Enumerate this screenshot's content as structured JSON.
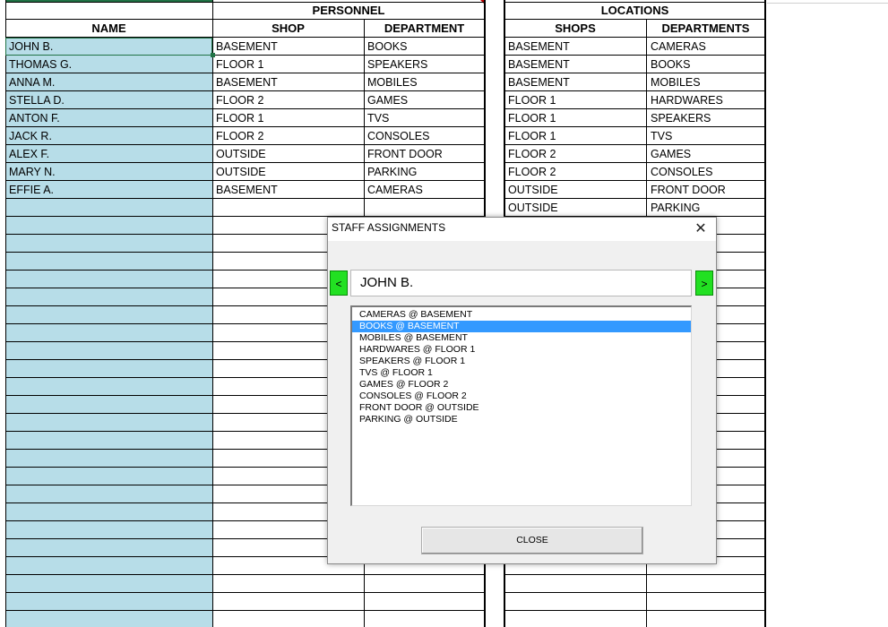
{
  "personnel": {
    "title": "PERSONNEL",
    "headers": {
      "name": "NAME",
      "shop": "SHOP",
      "department": "DEPARTMENT"
    },
    "rows": [
      {
        "name": "JOHN B.",
        "shop": "BASEMENT",
        "department": "BOOKS"
      },
      {
        "name": "THOMAS G.",
        "shop": "FLOOR 1",
        "department": "SPEAKERS"
      },
      {
        "name": "ANNA M.",
        "shop": "BASEMENT",
        "department": "MOBILES"
      },
      {
        "name": "STELLA D.",
        "shop": "FLOOR 2",
        "department": "GAMES"
      },
      {
        "name": "ANTON F.",
        "shop": "FLOOR 1",
        "department": "TVS"
      },
      {
        "name": "JACK R.",
        "shop": "FLOOR 2",
        "department": "CONSOLES"
      },
      {
        "name": "ALEX F.",
        "shop": "OUTSIDE",
        "department": "FRONT DOOR"
      },
      {
        "name": "MARY N.",
        "shop": "OUTSIDE",
        "department": "PARKING"
      },
      {
        "name": "EFFIE A.",
        "shop": "BASEMENT",
        "department": "CAMERAS"
      }
    ]
  },
  "locations": {
    "title": "LOCATIONS",
    "headers": {
      "shops": "SHOPS",
      "departments": "DEPARTMENTS"
    },
    "rows": [
      {
        "shop": "BASEMENT",
        "department": "CAMERAS"
      },
      {
        "shop": "BASEMENT",
        "department": "BOOKS"
      },
      {
        "shop": "BASEMENT",
        "department": "MOBILES"
      },
      {
        "shop": "FLOOR 1",
        "department": "HARDWARES"
      },
      {
        "shop": "FLOOR 1",
        "department": "SPEAKERS"
      },
      {
        "shop": "FLOOR 1",
        "department": "TVS"
      },
      {
        "shop": "FLOOR 2",
        "department": "GAMES"
      },
      {
        "shop": "FLOOR 2",
        "department": "CONSOLES"
      },
      {
        "shop": "OUTSIDE",
        "department": "FRONT DOOR"
      },
      {
        "shop": "OUTSIDE",
        "department": "PARKING"
      }
    ]
  },
  "dialog": {
    "title": "STAFF ASSIGNMENTS",
    "close_glyph": "✕",
    "prev_label": "<",
    "next_label": ">",
    "current_name": "JOHN B.",
    "list_items": [
      "CAMERAS @ BASEMENT",
      "BOOKS @ BASEMENT",
      "MOBILES @ BASEMENT",
      "HARDWARES @ FLOOR 1",
      "SPEAKERS @ FLOOR 1",
      "TVS @ FLOOR 1",
      "GAMES @ FLOOR 2",
      "CONSOLES @ FLOOR 2",
      "FRONT DOOR @ OUTSIDE",
      "PARKING @ OUTSIDE"
    ],
    "selected_item": "BOOKS @ BASEMENT",
    "close_button_label": "CLOSE"
  },
  "colors": {
    "name_column_fill": "#b7dde8",
    "selection_highlight": "#3399ff",
    "nav_button_green": "#22e022",
    "excel_green": "#217346"
  }
}
